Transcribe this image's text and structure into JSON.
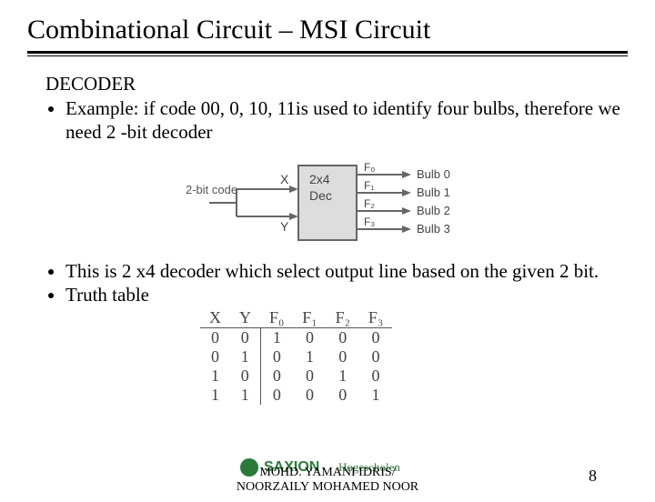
{
  "title": "Combinational Circuit – MSI Circuit",
  "section_heading": "DECODER",
  "bullet1": "Example: if code 00, 0, 10, 11is used to identify four bulbs, therefore we need 2 -bit decoder",
  "bullet2": "This is 2 x4 decoder which select output line based on the given 2 bit.",
  "bullet3": "Truth table",
  "diagram": {
    "input_label": "2-bit code",
    "box_top": "2x4",
    "box_bottom": "Dec",
    "x": "X",
    "y": "Y",
    "outputs": [
      {
        "pin": "F₀",
        "label": "Bulb 0"
      },
      {
        "pin": "F₁",
        "label": "Bulb 1"
      },
      {
        "pin": "F₂",
        "label": "Bulb 2"
      },
      {
        "pin": "F₃",
        "label": "Bulb 3"
      }
    ]
  },
  "truth_table": {
    "headers": [
      "X",
      "Y",
      "F₀",
      "F₁",
      "F₂",
      "F₃"
    ],
    "rows": [
      [
        "0",
        "0",
        "1",
        "0",
        "0",
        "0"
      ],
      [
        "0",
        "1",
        "0",
        "1",
        "0",
        "0"
      ],
      [
        "1",
        "0",
        "0",
        "0",
        "1",
        "0"
      ],
      [
        "1",
        "1",
        "0",
        "0",
        "0",
        "1"
      ]
    ]
  },
  "footer": {
    "author_line1": "MOHD. YAMANI IDRIS/",
    "author_line2": "NOORZAILY MOHAMED NOOR",
    "pagenum": "8",
    "logo_text1": "SAXION",
    "logo_text2": "Hogescholen"
  }
}
